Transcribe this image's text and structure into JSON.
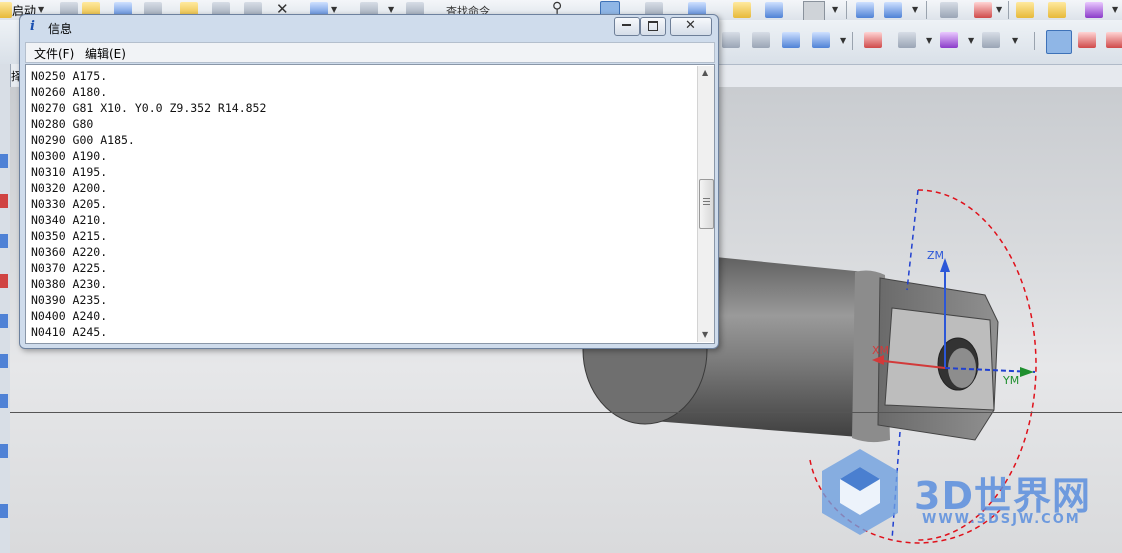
{
  "toolbar": {
    "start_label": "启动",
    "find_command_label": "查找命令",
    "selection_label": "选择过"
  },
  "info_window": {
    "icon_label": "i",
    "title": "信息",
    "menu": {
      "file": "文件(F)",
      "edit": "编辑(E)"
    },
    "lines": [
      "N0250 A175.",
      "N0260 A180.",
      "N0270 G81 X10. Y0.0 Z9.352 R14.852",
      "N0280 G80",
      "N0290 G00 A185.",
      "N0300 A190.",
      "N0310 A195.",
      "N0320 A200.",
      "N0330 A205.",
      "N0340 A210.",
      "N0350 A215.",
      "N0360 A220.",
      "N0370 A225.",
      "N0380 A230.",
      "N0390 A235.",
      "N0400 A240.",
      "N0410 A245."
    ]
  },
  "viewport": {
    "axis_labels": {
      "z": "ZM",
      "x": "XM",
      "y": "YM"
    },
    "axis_colors": {
      "z": "#2c57d8",
      "x": "#d23a3a",
      "y": "#1f8f2f"
    }
  },
  "watermark": {
    "brand": "3D世界网",
    "url": "WWW.3DSJW.COM"
  }
}
